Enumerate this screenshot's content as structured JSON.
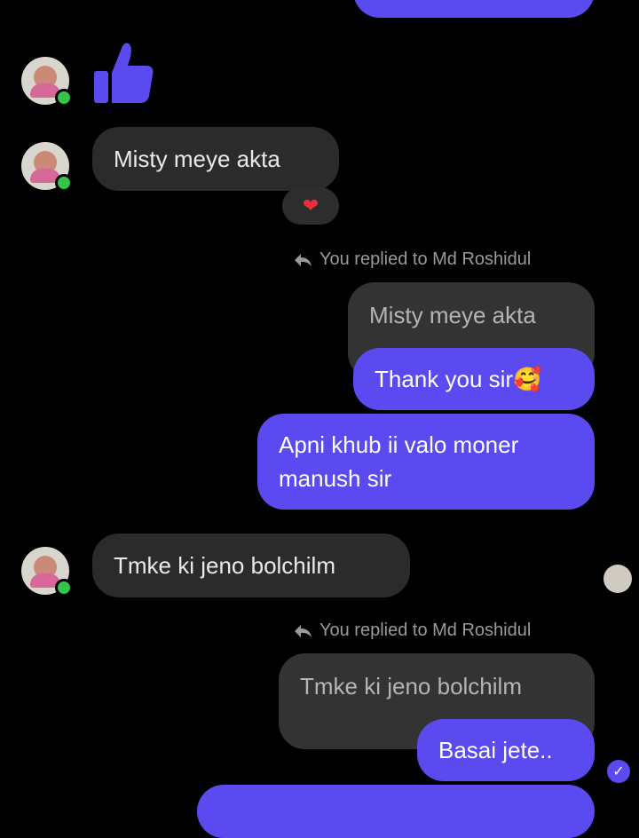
{
  "messages": {
    "misty_in": "Misty meye akta",
    "reaction_icon": "heart-icon",
    "reply1_label": "You replied to Md Roshidul",
    "reply1_quote": "Misty meye akta",
    "thank_you": "Thank you sir🥰",
    "apni_line1": "Apni khub ii valo moner",
    "apni_line2": "manush sir",
    "tmke_in": "Tmke ki jeno bolchilm",
    "reply2_label": "You replied to Md Roshidul",
    "reply2_quote": "Tmke ki jeno bolchilm",
    "basai": "Basai jete.."
  },
  "colors": {
    "outgoing": "#5b4af0",
    "incoming": "#2b2b2b",
    "online": "#35c44a"
  }
}
